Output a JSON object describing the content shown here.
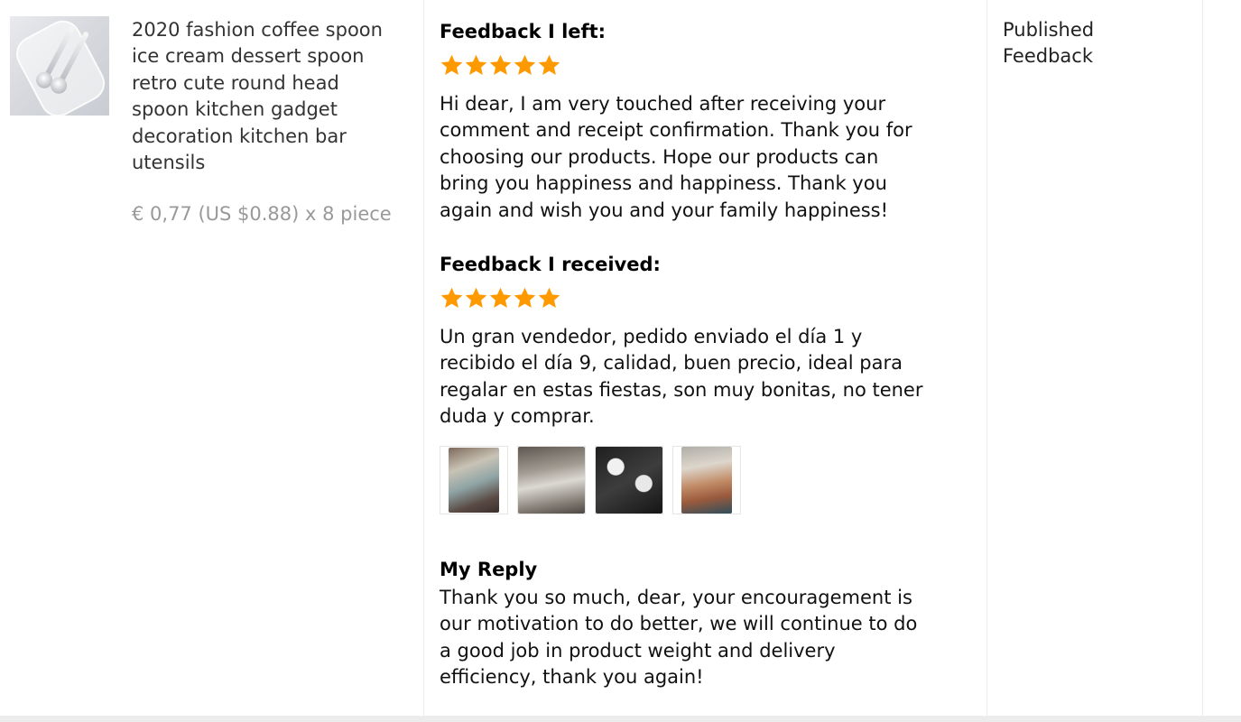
{
  "product": {
    "title": "2020 fashion coffee spoon\nice cream dessert spoon\nretro cute round head\nspoon kitchen gadget\ndecoration kitchen bar\nutensils",
    "price": "€ 0,77 (US $0.88) x 8 piece",
    "thumbnail_icon": "spoon-set-image"
  },
  "feedback_left": {
    "heading": "Feedback I left:",
    "rating": 5,
    "max_rating": 5,
    "star_color": "#f90",
    "text": "Hi dear, I am very touched after receiving your\ncomment and receipt confirmation. Thank you for\nchoosing our products. Hope our products can\nbring you happiness and happiness. Thank you\nagain and wish you and your family happiness!"
  },
  "feedback_received": {
    "heading": "Feedback I received:",
    "rating": 5,
    "max_rating": 5,
    "star_color": "#f90",
    "text": "Un gran vendedor, pedido enviado el día 1 y\nrecibido el día 9, calidad, buen precio, ideal para\nregalar en estas fiestas, son muy bonitas, no tener\nduda y comprar.",
    "photo_count": 4
  },
  "reply": {
    "heading": "My Reply",
    "text": "Thank you so much, dear, your encouragement is\nour motivation to do better, we will continue to do\na good job in product weight and delivery\nefficiency, thank you again!"
  },
  "status": {
    "label": "Published\nFeedback"
  }
}
